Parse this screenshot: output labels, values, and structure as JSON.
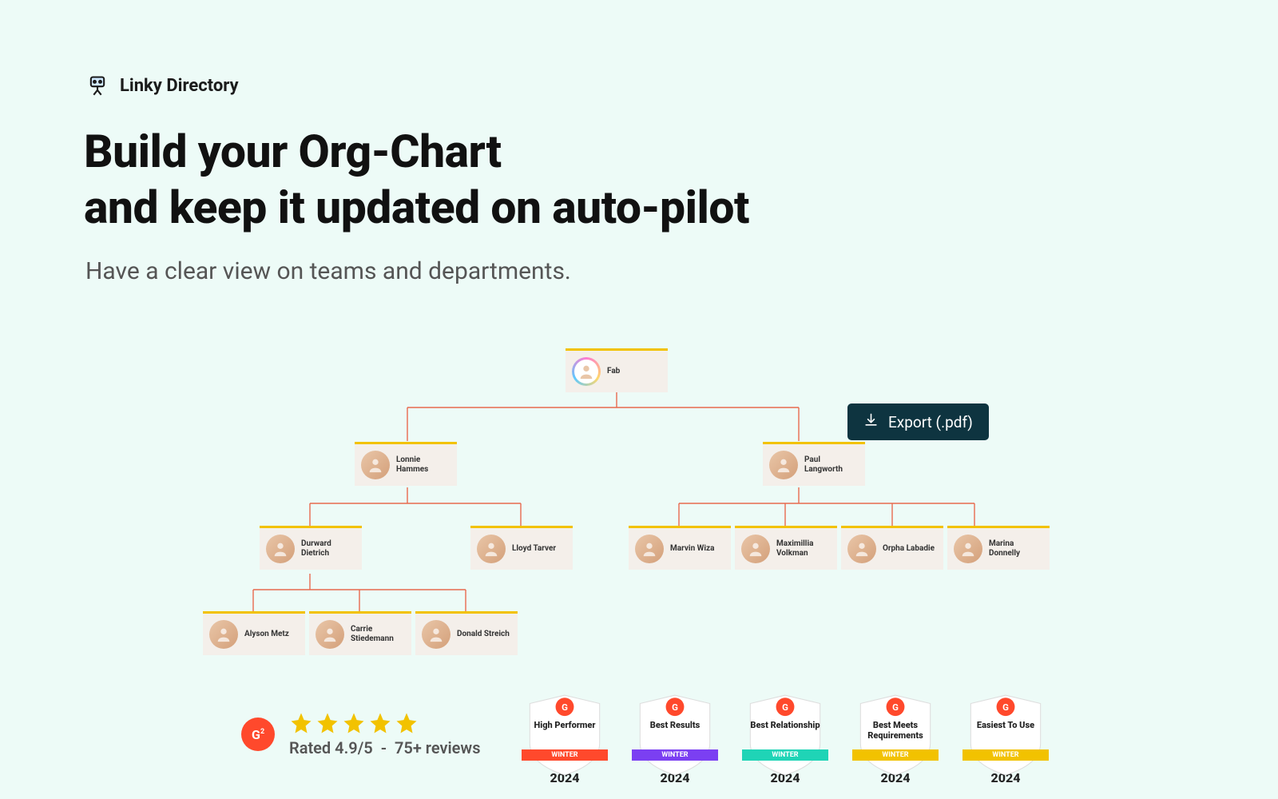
{
  "brand": {
    "name": "Linky Directory"
  },
  "headline": {
    "line1": "Build your Org-Chart",
    "line2": "and keep it updated on auto-pilot"
  },
  "subhead": "Have a clear view on teams and departments.",
  "export_button": {
    "label": "Export (.pdf)"
  },
  "org": {
    "root": {
      "name": "Fab"
    },
    "level2": [
      {
        "name": "Lonnie Hammes"
      },
      {
        "name": "Paul Langworth"
      }
    ],
    "level3_left": [
      {
        "name": "Durward Dietrich"
      },
      {
        "name": "Lloyd Tarver"
      }
    ],
    "level3_right": [
      {
        "name": "Marvin Wiza"
      },
      {
        "name": "Maximillia Volkman"
      },
      {
        "name": "Orpha Labadie"
      },
      {
        "name": "Marina Donnelly"
      }
    ],
    "level4": [
      {
        "name": "Alyson Metz"
      },
      {
        "name": "Carrie Stiedemann"
      },
      {
        "name": "Donald Streich"
      }
    ]
  },
  "ratings": {
    "score_text": "Rated 4.9/5",
    "separator": "-",
    "reviews_text": "75+ reviews"
  },
  "badges": [
    {
      "title": "High Performer",
      "color": "#ff492c",
      "year": "2024",
      "banner": "WINTER"
    },
    {
      "title": "Best Results",
      "color": "#7b3ff2",
      "year": "2024",
      "banner": "WINTER"
    },
    {
      "title": "Best Relationship",
      "color": "#1fd4b6",
      "year": "2024",
      "banner": "WINTER"
    },
    {
      "title": "Best Meets Requirements",
      "color": "#f2c200",
      "year": "2024",
      "banner": "WINTER"
    },
    {
      "title": "Easiest To Use",
      "color": "#f2c200",
      "year": "2024",
      "banner": "WINTER"
    }
  ]
}
